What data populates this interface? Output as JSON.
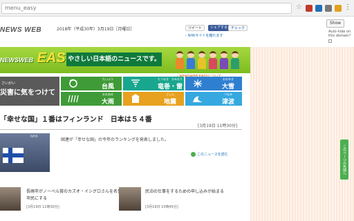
{
  "browser": {
    "url": "menu_easy",
    "menu_glyph": "⋮",
    "star_glyph": "☆"
  },
  "header": {
    "brand": "NEWS WEB",
    "date": "2018年（平成30年）3月19日［月曜日］",
    "share_tweet": "ツイート",
    "share_facebook": "シェアする",
    "share_hatena": "チェック",
    "site_link": "› NHKサイトを離れます"
  },
  "sidebar": {
    "show_label": "Show",
    "autohide_label": "Auto-hide on this domain?",
    "side_tab_label": "このページの先頭へ"
  },
  "banner": {
    "logo_small": "NEWSWEB",
    "logo_easy": "EASY",
    "subtitle": "やさしい日本語のニュースです。",
    "about_link": "› NEWSWEB EASYについて",
    "accent_color": "#7cbc20"
  },
  "disaster": {
    "ruby": "さいがい",
    "title": "災害に気をつけて",
    "tiles": [
      {
        "ruby": "たいふう",
        "name": "台風",
        "icon": "typhoon-icon",
        "color": "#3f9b37"
      },
      {
        "ruby": "たつまき　かみなり",
        "name": "竜巻・雷",
        "icon": "tornado-icon",
        "color": "#19a68f"
      },
      {
        "ruby": "おおゆき",
        "name": "大雪",
        "icon": "snow-icon",
        "color": "#2f7fd0"
      },
      {
        "ruby": "おおあめ",
        "name": "大雨",
        "icon": "rain-icon",
        "color": "#3f9b37"
      },
      {
        "ruby": "じしん",
        "name": "地震",
        "icon": "earthquake-icon",
        "color": "#e8a11e"
      },
      {
        "ruby": "つなみ",
        "name": "津波",
        "icon": "tsunami-icon",
        "color": "#35a8e0"
      }
    ]
  },
  "article": {
    "headline": "「幸せな国」１番はフィンランド　日本は５４番",
    "date": "[3月19日 11時30分]",
    "lead": "国連が「幸せな国」の今年のランキングを発表しました。",
    "read_more": "このニュースを読む",
    "thumb_caption": "NHK"
  },
  "news_list": [
    {
      "title": "長崎市がノーベル賞のカズオ・イシグロさんを名誉市民にする",
      "date": "[3月19日 11時30分]"
    },
    {
      "title": "民泊の仕事をするための申し込みが始まる",
      "date": "[3月16日 15時45分]"
    }
  ]
}
